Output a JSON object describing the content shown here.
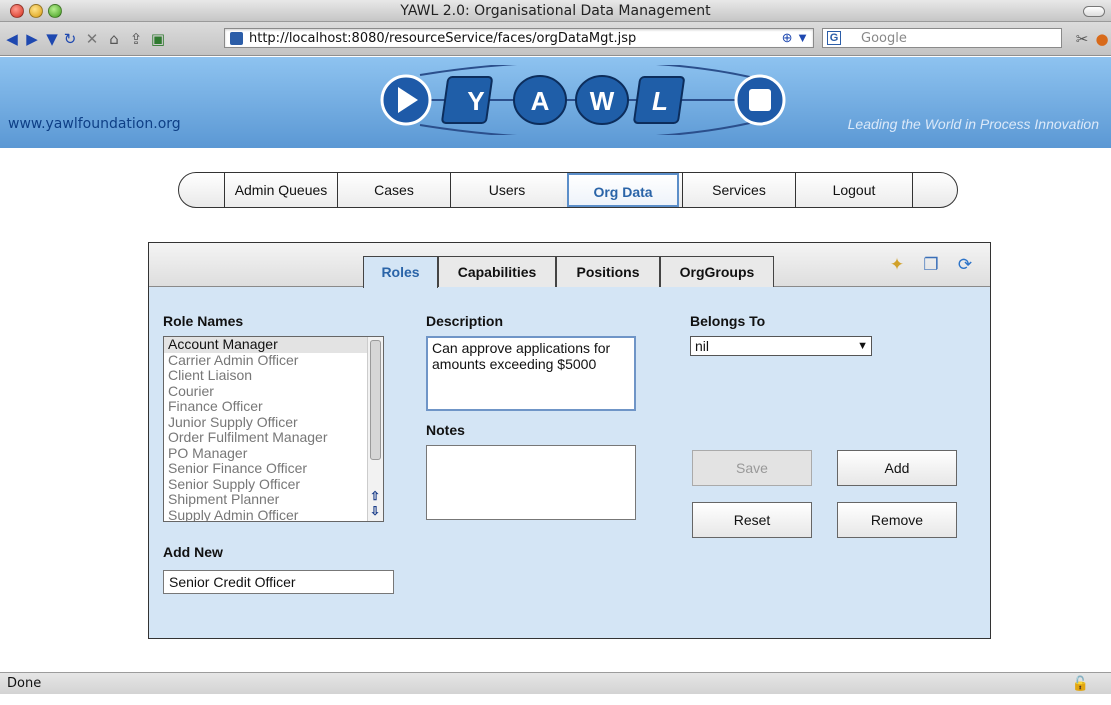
{
  "window": {
    "title": "YAWL 2.0: Organisational Data Management"
  },
  "browser": {
    "url": "http://localhost:8080/resourceService/faces/orgDataMgt.jsp",
    "search_placeholder": "Google",
    "status": "Done"
  },
  "banner": {
    "site": "www.yawlfoundation.org",
    "tagline": "Leading the World in Process Innovation",
    "logo_letters": [
      "Y",
      "A",
      "W",
      "L"
    ]
  },
  "menu": {
    "items": [
      "Admin Queues",
      "Cases",
      "Users",
      "Org Data",
      "Services",
      "Logout"
    ],
    "active": "Org Data"
  },
  "tabs": {
    "items": [
      "Roles",
      "Capabilities",
      "Positions",
      "OrgGroups"
    ],
    "active": "Roles"
  },
  "form": {
    "role_names_label": "Role Names",
    "roles": [
      "Account Manager",
      "Carrier Admin Officer",
      "Client Liaison",
      "Courier",
      "Finance Officer",
      "Junior Supply Officer",
      "Order Fulfilment Manager",
      "PO Manager",
      "Senior Finance Officer",
      "Senior Supply Officer",
      "Shipment Planner",
      "Supply Admin Officer"
    ],
    "selected_role": "Account Manager",
    "description_label": "Description",
    "description": "Can approve applications for amounts exceeding $5000",
    "notes_label": "Notes",
    "notes": "",
    "belongs_to_label": "Belongs To",
    "belongs_to": "nil",
    "add_new_label": "Add New",
    "add_new_value": "Senior Credit Officer"
  },
  "buttons": {
    "save": "Save",
    "add": "Add",
    "reset": "Reset",
    "remove": "Remove"
  }
}
